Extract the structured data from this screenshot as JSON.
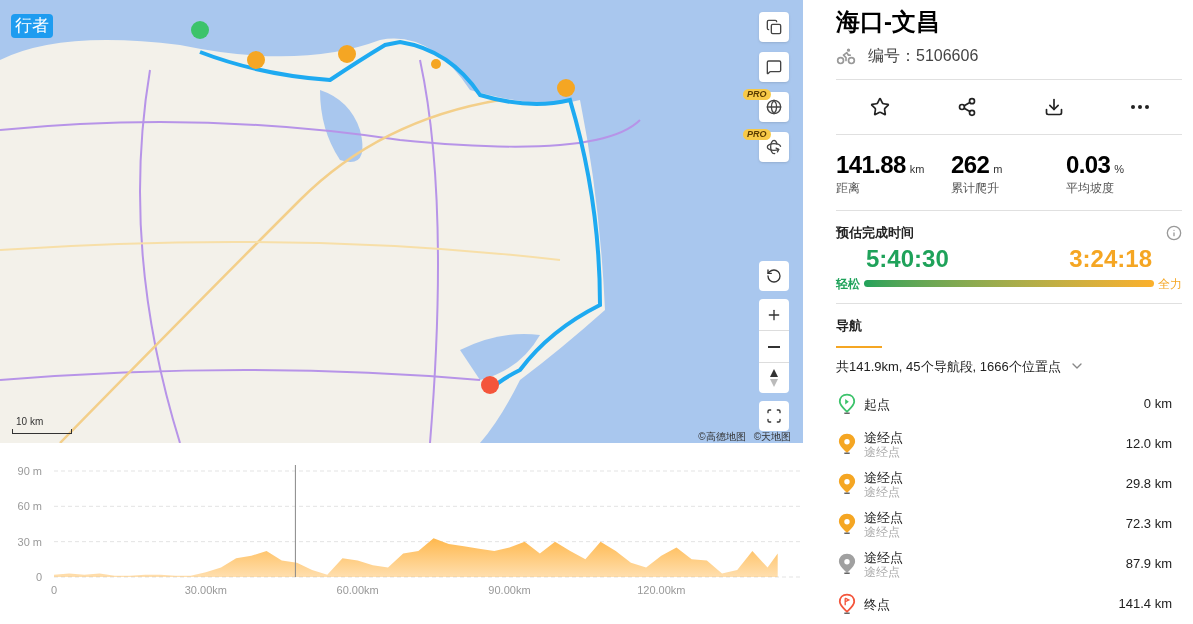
{
  "map": {
    "logo": "行者",
    "scale": "10 km",
    "attribution": [
      "©高德地图",
      "©天地图"
    ],
    "controls": [
      {
        "kind": "layers"
      },
      {
        "kind": "note"
      },
      {
        "kind": "globe",
        "badge": "PRO"
      },
      {
        "kind": "tilt",
        "badge": "PRO"
      }
    ]
  },
  "elevation": {
    "chart_data": {
      "type": "area",
      "grid": true,
      "ref_lines": [
        {
          "axis": "x",
          "value": 47.7,
          "color": "#888888"
        }
      ],
      "xlim": [
        0,
        148
      ],
      "ylim": [
        0,
        95
      ],
      "yticks": [
        {
          "value": 0,
          "label": "0"
        },
        {
          "value": 30,
          "label": "30 m"
        },
        {
          "value": 60,
          "label": "60 m"
        },
        {
          "value": 90,
          "label": "90 m"
        }
      ],
      "xticks": [
        {
          "value": 0,
          "label": "0"
        },
        {
          "value": 30,
          "label": "30.00km"
        },
        {
          "value": 60,
          "label": "60.00km"
        },
        {
          "value": 90,
          "label": "90.00km"
        },
        {
          "value": 120,
          "label": "120.00km"
        }
      ],
      "x": [
        0,
        3,
        6,
        9,
        12,
        15,
        18,
        21,
        24,
        27,
        30,
        33,
        36,
        39,
        42,
        45,
        48,
        51,
        54,
        57,
        60,
        63,
        66,
        69,
        72,
        75,
        78,
        81,
        84,
        87,
        90,
        93,
        96,
        99,
        102,
        105,
        108,
        111,
        114,
        117,
        120,
        123,
        126,
        129,
        132,
        135,
        138,
        141,
        143
      ],
      "series": [
        {
          "color": "#ffb84d",
          "values": [
            2,
            3,
            2,
            3,
            1,
            1,
            2,
            2,
            1,
            1,
            4,
            8,
            16,
            18,
            22,
            14,
            12,
            6,
            2,
            16,
            14,
            10,
            8,
            20,
            22,
            33,
            28,
            26,
            24,
            22,
            25,
            30,
            20,
            30,
            22,
            15,
            30,
            22,
            12,
            8,
            18,
            25,
            15,
            14,
            3,
            6,
            22,
            8,
            20
          ]
        }
      ]
    }
  },
  "route": {
    "title": "海口-文昌",
    "number_label": "编号：",
    "number": "5106606",
    "stats": [
      {
        "value": "141.88",
        "unit": "km",
        "label": "距离"
      },
      {
        "value": "262",
        "unit": "m",
        "label": "累计爬升"
      },
      {
        "value": "0.03",
        "unit": "%",
        "label": "平均坡度"
      }
    ],
    "estimate": {
      "title": "预估完成时间",
      "easy_time": "5:40:30",
      "max_time": "3:24:18",
      "easy_label": "轻松",
      "max_label": "全力"
    }
  },
  "tabs": [
    {
      "label": "导航",
      "selected": true
    }
  ],
  "summary": {
    "text": "共141.9km, 45个导航段, 1666个位置点",
    "expanded": false
  },
  "points": [
    {
      "kind": "start",
      "name": "起点",
      "distance": "0 km",
      "color": "#3cc36b"
    },
    {
      "kind": "waypoint",
      "name": "途经点",
      "subtitle": "途经点",
      "distance": "12.0 km",
      "color": "#f5a623"
    },
    {
      "kind": "waypoint",
      "name": "途经点",
      "subtitle": "途经点",
      "distance": "29.8 km",
      "color": "#f5a623"
    },
    {
      "kind": "waypoint",
      "name": "途经点",
      "subtitle": "途经点",
      "distance": "72.3 km",
      "color": "#f5a623"
    },
    {
      "kind": "waypoint",
      "name": "途经点",
      "subtitle": "途经点",
      "distance": "87.9 km",
      "color": "#a0a0a0"
    },
    {
      "kind": "end",
      "name": "终点",
      "distance": "141.4 km",
      "color": "#f4553b"
    }
  ]
}
